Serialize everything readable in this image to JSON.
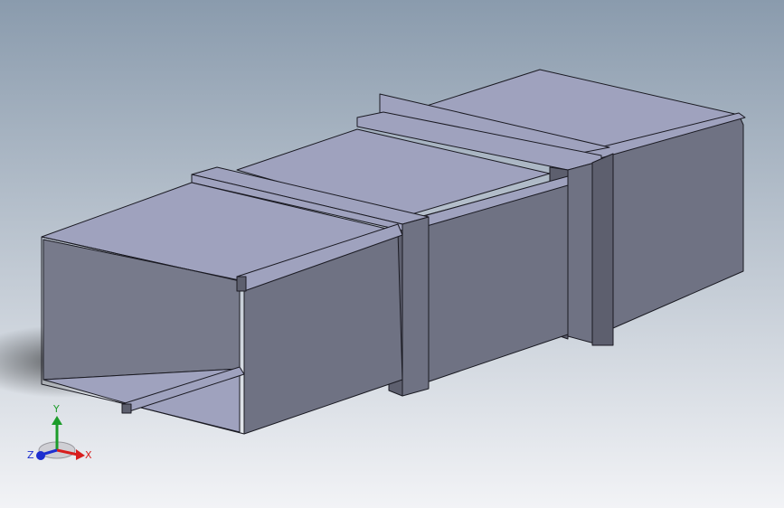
{
  "viewport": {
    "background_top": "#8a9bad",
    "background_bottom": "#f2f3f6"
  },
  "model": {
    "face_top": "#9fa2be",
    "face_side": "#6f7283",
    "face_dark": "#5d5f6e",
    "face_inner": "#777a8b",
    "edge": "#1a1a22"
  },
  "triad": {
    "x_label": "X",
    "y_label": "Y",
    "z_label": "Z",
    "x_color": "#d81e1e",
    "y_color": "#1c9c2a",
    "z_color": "#1d2fd0"
  }
}
